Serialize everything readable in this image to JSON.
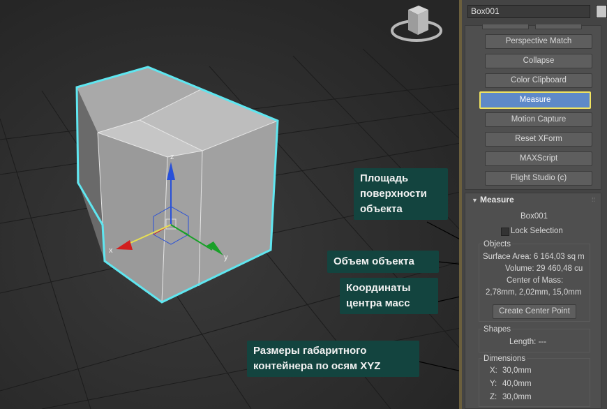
{
  "panel": {
    "object_name": "Box001",
    "utility_buttons": [
      "Perspective Match",
      "Collapse",
      "Color Clipboard",
      "Measure",
      "Motion Capture",
      "Reset XForm",
      "MAXScript",
      "Flight Studio (c)"
    ],
    "active_button": "Measure",
    "rollout": {
      "title": "Measure",
      "object_label": "Box001",
      "lock_selection": "Lock Selection",
      "objects_group": "Objects",
      "surface_area": "Surface Area: 6 164,03 sq m",
      "volume": "Volume:  29 460,48 cu",
      "center_of_mass_label": "Center of Mass:",
      "center_of_mass_value": "2,78mm, 2,02mm, 15,0mm",
      "create_center_point": "Create Center Point",
      "shapes_group": "Shapes",
      "length": "Length: ---",
      "dimensions_group": "Dimensions",
      "dim_x_label": "X:",
      "dim_x": "30,0mm",
      "dim_y_label": "Y:",
      "dim_y": "40,0mm",
      "dim_z_label": "Z:",
      "dim_z": "30,0mm"
    }
  },
  "callouts": {
    "surface_area": [
      "Площадь",
      "поверхности",
      "объекта"
    ],
    "volume": "Объем объекта",
    "center_of_mass": [
      "Координаты",
      "центра масс"
    ],
    "dimensions": [
      "Размеры габаритного",
      "контейнера по осям XYZ"
    ]
  },
  "gizmo": {
    "x_label": "x",
    "y_label": "y",
    "z_label": "z"
  },
  "colors": {
    "selection_outline": "#5fe6f0",
    "active_button": "#5e89c8",
    "active_border": "#f2e460",
    "callout_bg": "#13443f",
    "x_axis": "#d21e1e",
    "y_axis": "#18a028",
    "z_axis": "#2850d8"
  }
}
